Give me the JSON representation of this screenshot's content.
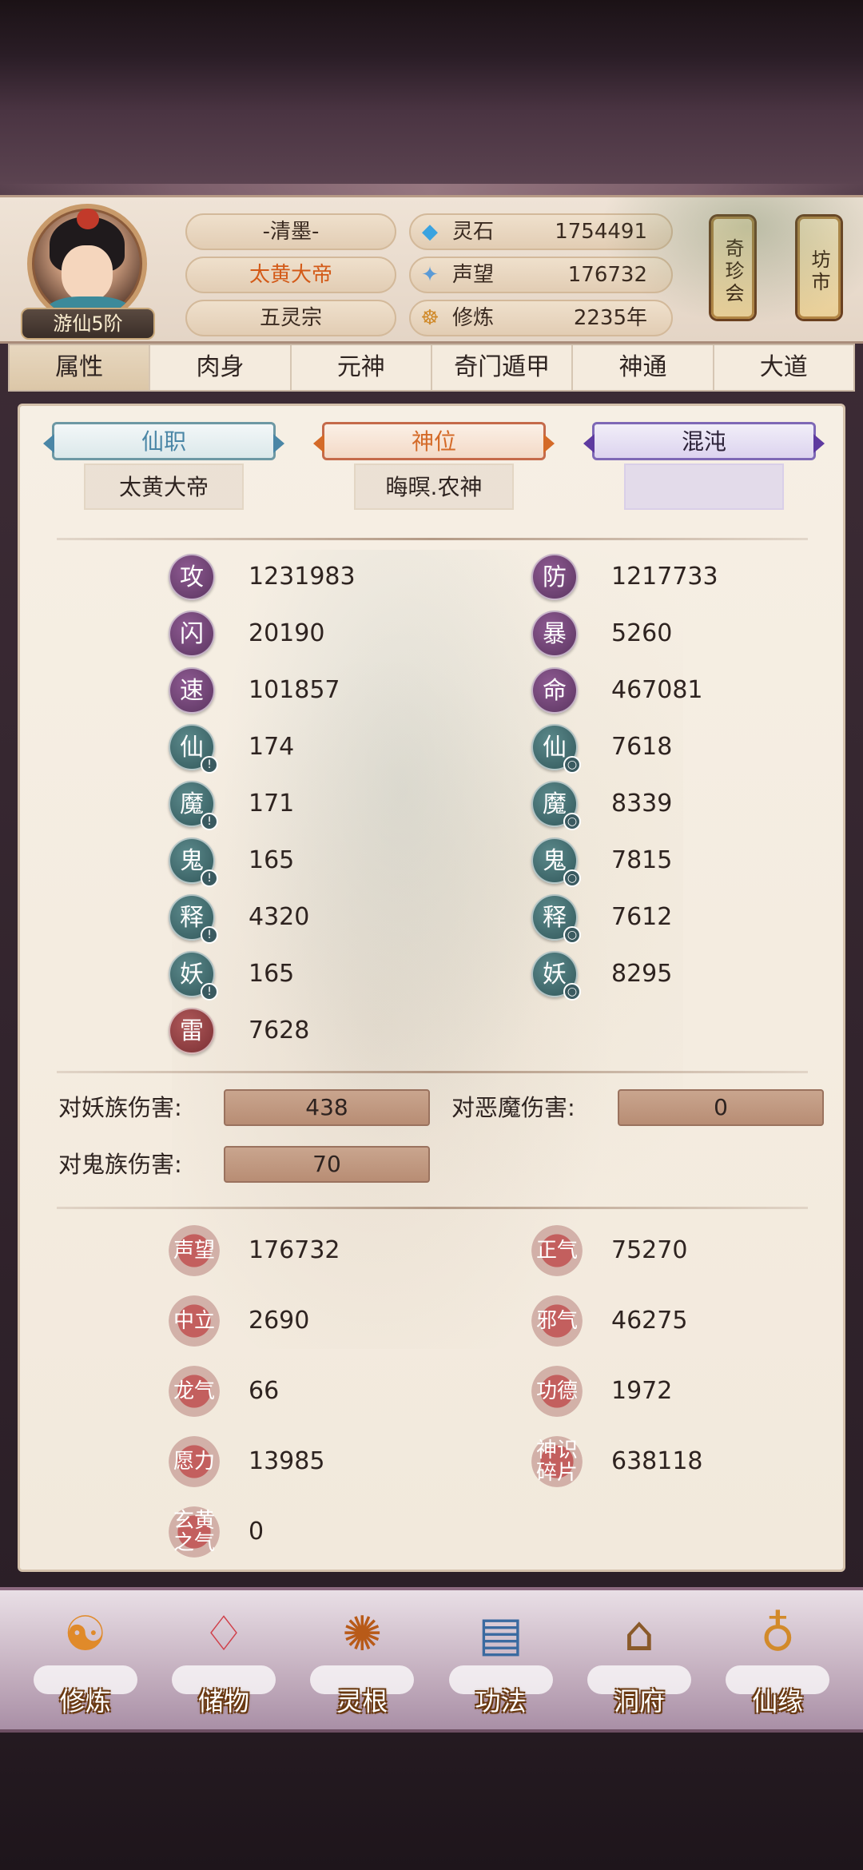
{
  "player": {
    "rank": "游仙5阶",
    "name": "-清墨-",
    "title": "太黄大帝",
    "sect": "五灵宗"
  },
  "resources": [
    {
      "icon": "spirit-stone-icon",
      "label": "灵石",
      "value": "1754491"
    },
    {
      "icon": "reputation-icon",
      "label": "声望",
      "value": "176732"
    },
    {
      "icon": "cultivation-icon",
      "label": "修炼",
      "value": "2235年"
    }
  ],
  "side_buttons": {
    "treasure": "奇珍会",
    "market": "坊市"
  },
  "tabs": [
    "属性",
    "肉身",
    "元神",
    "奇门遁甲",
    "神通",
    "大道"
  ],
  "titles": {
    "immortal_post": {
      "head": "仙职",
      "value": "太黄大帝"
    },
    "god_post": {
      "head": "神位",
      "value": "晦暝.农神"
    },
    "chaos": {
      "head": "混沌",
      "value": ""
    }
  },
  "stats_left": [
    {
      "glyph": "攻",
      "value": "1231983"
    },
    {
      "glyph": "闪",
      "value": "20190"
    },
    {
      "glyph": "速",
      "value": "101857"
    },
    {
      "glyph": "仙",
      "value": "174"
    },
    {
      "glyph": "魔",
      "value": "171"
    },
    {
      "glyph": "鬼",
      "value": "165"
    },
    {
      "glyph": "释",
      "value": "4320"
    },
    {
      "glyph": "妖",
      "value": "165"
    },
    {
      "glyph": "雷",
      "value": "7628"
    }
  ],
  "stats_right": [
    {
      "glyph": "防",
      "value": "1217733"
    },
    {
      "glyph": "暴",
      "value": "5260"
    },
    {
      "glyph": "命",
      "value": "467081"
    },
    {
      "glyph": "仙",
      "value": "7618"
    },
    {
      "glyph": "魔",
      "value": "8339"
    },
    {
      "glyph": "鬼",
      "value": "7815"
    },
    {
      "glyph": "释",
      "value": "7612"
    },
    {
      "glyph": "妖",
      "value": "8295"
    }
  ],
  "damage": {
    "vs_demon_race_label": "对妖族伤害:",
    "vs_demon_race": "438",
    "vs_evil_demon_label": "对恶魔伤害:",
    "vs_evil_demon": "0",
    "vs_ghost_label": "对鬼族伤害:",
    "vs_ghost": "70"
  },
  "attributes_left": [
    {
      "label": "声望",
      "value": "176732"
    },
    {
      "label": "中立",
      "value": "2690"
    },
    {
      "label": "龙气",
      "value": "66"
    },
    {
      "label": "愿力",
      "value": "13985"
    },
    {
      "label": "玄黄之气",
      "value": "0"
    }
  ],
  "attributes_right": [
    {
      "label": "正气",
      "value": "75270"
    },
    {
      "label": "邪气",
      "value": "46275"
    },
    {
      "label": "功德",
      "value": "1972"
    },
    {
      "label": "神识碎片",
      "value": "638118"
    }
  ],
  "nav": [
    "修炼",
    "储物",
    "灵根",
    "功法",
    "洞府",
    "仙缘"
  ]
}
